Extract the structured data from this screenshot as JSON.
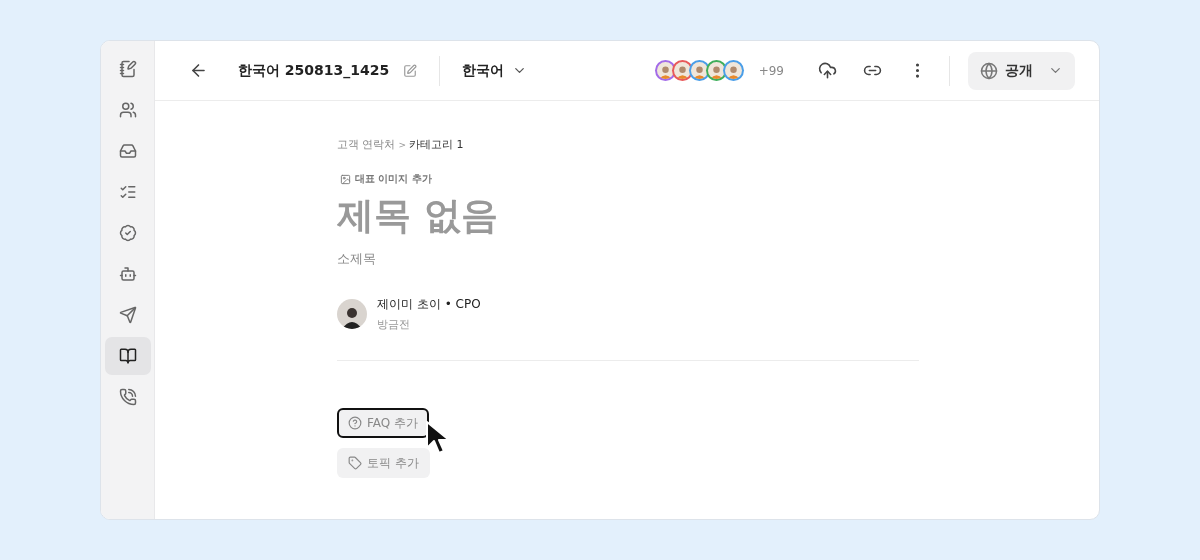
{
  "sidebar": {
    "items": [
      {
        "selected": false
      },
      {
        "selected": false
      },
      {
        "selected": false
      },
      {
        "selected": false
      },
      {
        "selected": false
      },
      {
        "selected": false
      },
      {
        "selected": false
      },
      {
        "selected": true
      },
      {
        "selected": false
      }
    ]
  },
  "header": {
    "title": "한국어 250813_1425",
    "language": "한국어",
    "collaborators": [
      {
        "color": "#a36be8"
      },
      {
        "color": "#e8595a"
      },
      {
        "color": "#4a9ee8"
      },
      {
        "color": "#3fae5a"
      },
      {
        "color": "#4a9ee8"
      }
    ],
    "more_count": "+99",
    "visibility": "공개"
  },
  "breadcrumb": {
    "items": [
      "고객 연락처",
      "카테고리 1"
    ],
    "separator": ">"
  },
  "cover_button": "대표 이미지 추가",
  "title": {
    "placeholder": "제목 없음"
  },
  "subtitle": {
    "placeholder": "소제목"
  },
  "author": {
    "name": "제이미 초이 • CPO",
    "time": "방금전"
  },
  "actions": [
    {
      "kind": "faq",
      "label": "FAQ 추가",
      "focused": true
    },
    {
      "kind": "topic",
      "label": "토픽 추가",
      "focused": false
    }
  ]
}
